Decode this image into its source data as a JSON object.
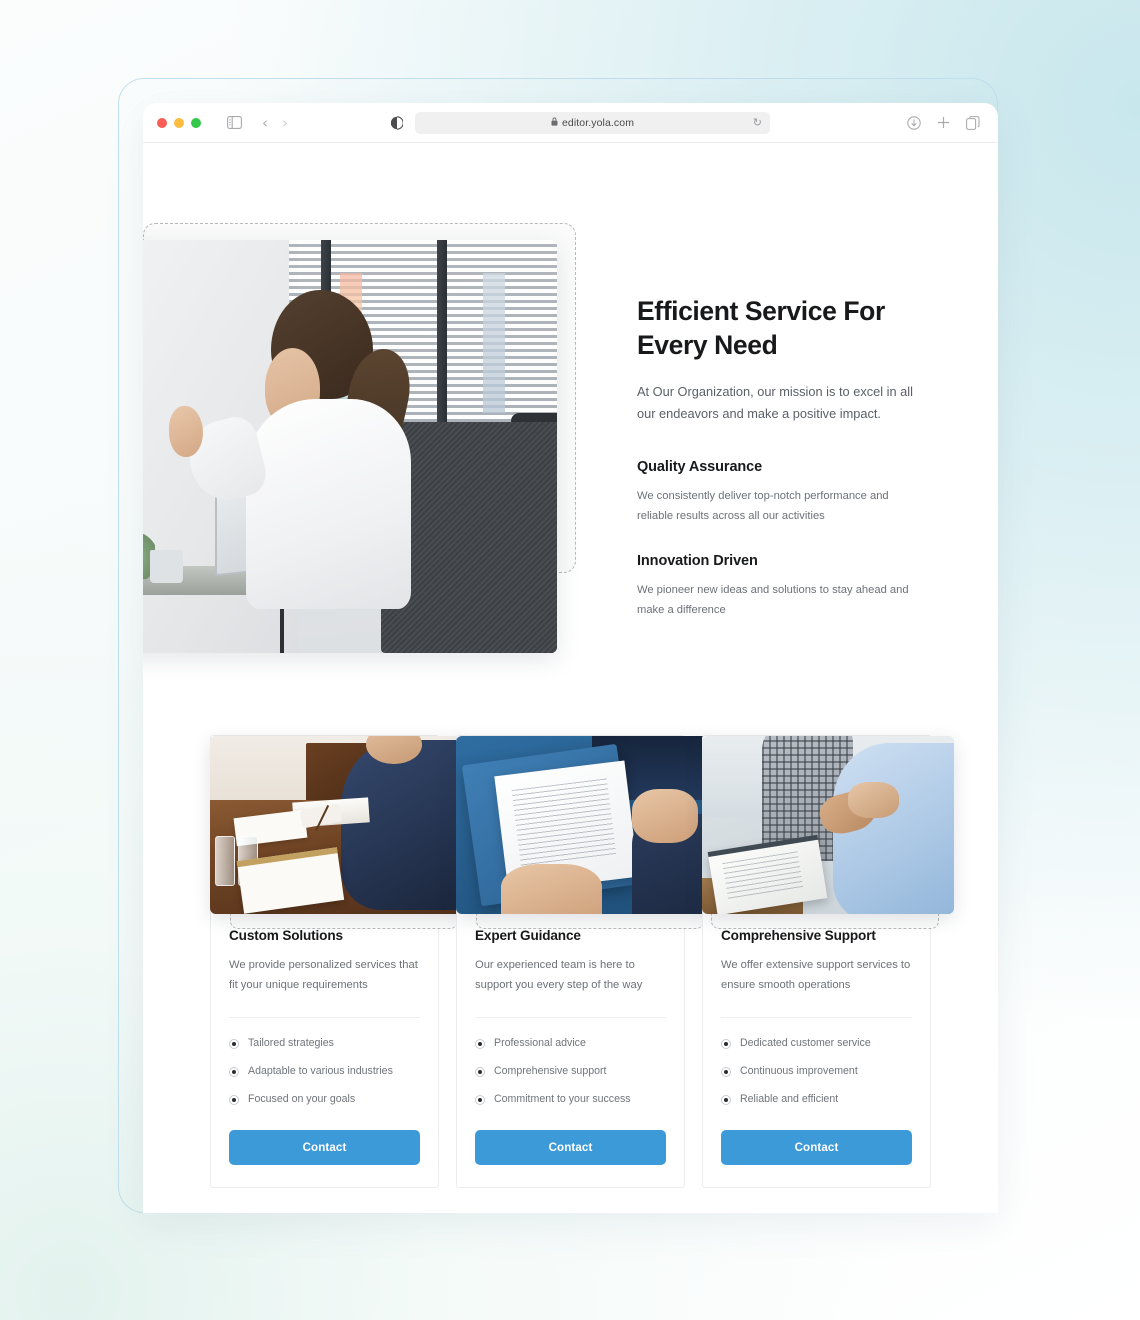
{
  "browser": {
    "url": "editor.yola.com",
    "lock_icon": "lock-icon",
    "reload_icon": "reload-icon",
    "traffic_lights": [
      "close-button",
      "minimize-button",
      "maximize-button"
    ],
    "left_icons": [
      "sidebar-toggle-icon",
      "back-arrow-icon",
      "forward-arrow-icon",
      "reader-view-icon"
    ],
    "right_icons": [
      "downloads-icon",
      "new-tab-icon",
      "tab-overview-icon"
    ],
    "back_glyph": "‹",
    "forward_glyph": "›",
    "reload_glyph": "↻",
    "lock_glyph": "🔒",
    "plus_glyph": "+"
  },
  "hero": {
    "title": "Efficient Service For Every Need",
    "subtitle": "At Our Organization, our mission is to excel in all our endeavors and make a positive impact.",
    "image_name": "hero-image-woman-at-desk",
    "features": [
      {
        "title": "Quality Assurance",
        "desc": "We consistently deliver top-notch performance and reliable results across all our activities"
      },
      {
        "title": "Innovation Driven",
        "desc": "We pioneer new ideas and solutions to stay ahead and make a difference"
      }
    ]
  },
  "cards": [
    {
      "image_name": "card-image-man-signing-document",
      "title": "Custom Solutions",
      "desc": "We provide personalized services that fit your unique requirements",
      "items": [
        "Tailored strategies",
        "Adaptable to various industries",
        "Focused on your goals"
      ],
      "button": "Contact"
    },
    {
      "image_name": "card-image-handing-blue-folder",
      "title": "Expert Guidance",
      "desc": "Our experienced team is here to support you every step of the way",
      "items": [
        "Professional advice",
        "Comprehensive support",
        "Commitment to your success"
      ],
      "button": "Contact"
    },
    {
      "image_name": "card-image-business-handshake",
      "title": "Comprehensive Support",
      "desc": "We offer extensive support services to ensure smooth operations",
      "items": [
        "Dedicated customer service",
        "Continuous improvement",
        "Reliable and efficient"
      ],
      "button": "Contact"
    }
  ],
  "colors": {
    "accent_blue": "#3d9ad8",
    "heading": "#18191b",
    "body_text": "#6d7177",
    "frame_border": "#bfdfec",
    "page_bg_top_right": "#c8e7ed"
  }
}
